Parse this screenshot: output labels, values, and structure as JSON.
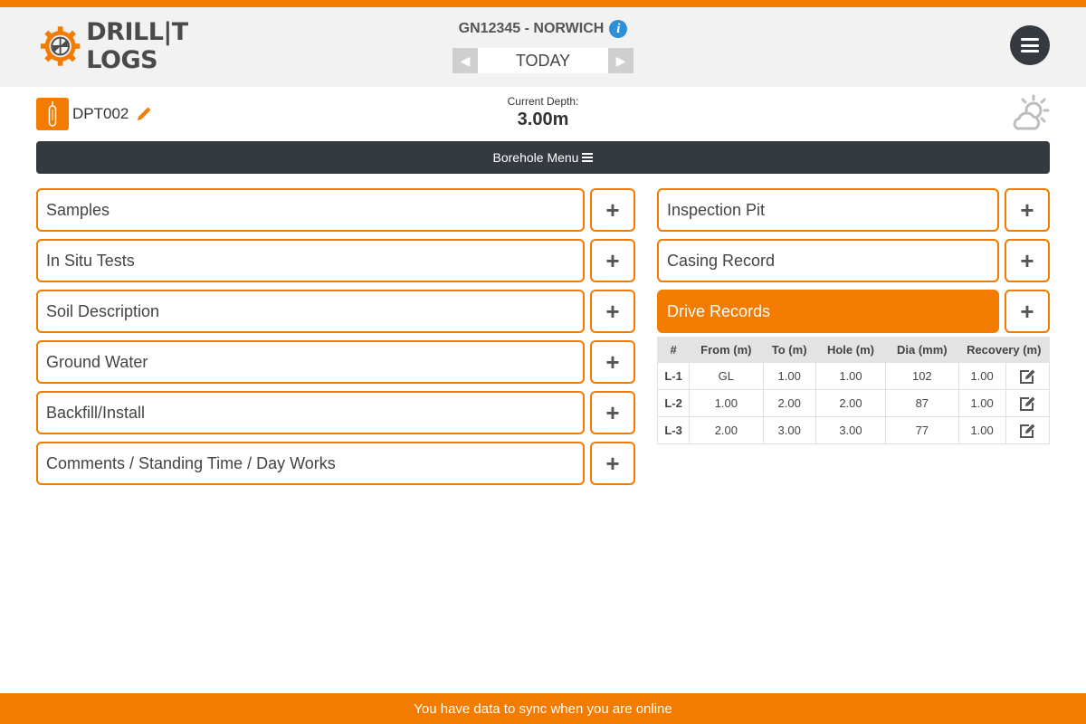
{
  "header": {
    "logo_text": "DRILL|T LOGS",
    "project_title": "GN12345 - NORWICH",
    "date_label": "TODAY"
  },
  "borehole": {
    "name": "DPT002",
    "depth_label": "Current Depth:",
    "depth_value": "3.00m",
    "menu_label": "Borehole Menu"
  },
  "left_items": [
    {
      "label": "Samples"
    },
    {
      "label": "In Situ Tests"
    },
    {
      "label": "Soil Description"
    },
    {
      "label": "Ground Water"
    },
    {
      "label": "Backfill/Install"
    },
    {
      "label": "Comments / Standing Time / Day Works"
    }
  ],
  "right_items": [
    {
      "label": "Inspection Pit"
    },
    {
      "label": "Casing Record"
    },
    {
      "label": "Drive Records"
    }
  ],
  "add_symbol": "+",
  "drive_table": {
    "headers": [
      "#",
      "From (m)",
      "To (m)",
      "Hole (m)",
      "Dia (mm)",
      "Recovery (m)"
    ],
    "rows": [
      {
        "id": "L-1",
        "from": "GL",
        "to": "1.00",
        "hole": "1.00",
        "dia": "102",
        "recovery": "1.00"
      },
      {
        "id": "L-2",
        "from": "1.00",
        "to": "2.00",
        "hole": "2.00",
        "dia": "87",
        "recovery": "1.00"
      },
      {
        "id": "L-3",
        "from": "2.00",
        "to": "3.00",
        "hole": "3.00",
        "dia": "77",
        "recovery": "1.00"
      }
    ]
  },
  "footer": {
    "message": "You have data to sync when you are online"
  },
  "icons": {
    "info": "info-icon",
    "prev": "arrow-left-icon",
    "next": "arrow-right-icon",
    "menu": "hamburger-icon",
    "borehole": "borehole-icon",
    "edit": "pencil-icon",
    "weather": "partly-cloudy-icon",
    "row_edit": "edit-square-icon"
  },
  "colors": {
    "accent": "#f27b00",
    "dark": "#343a40",
    "info": "#2d8fd6"
  }
}
